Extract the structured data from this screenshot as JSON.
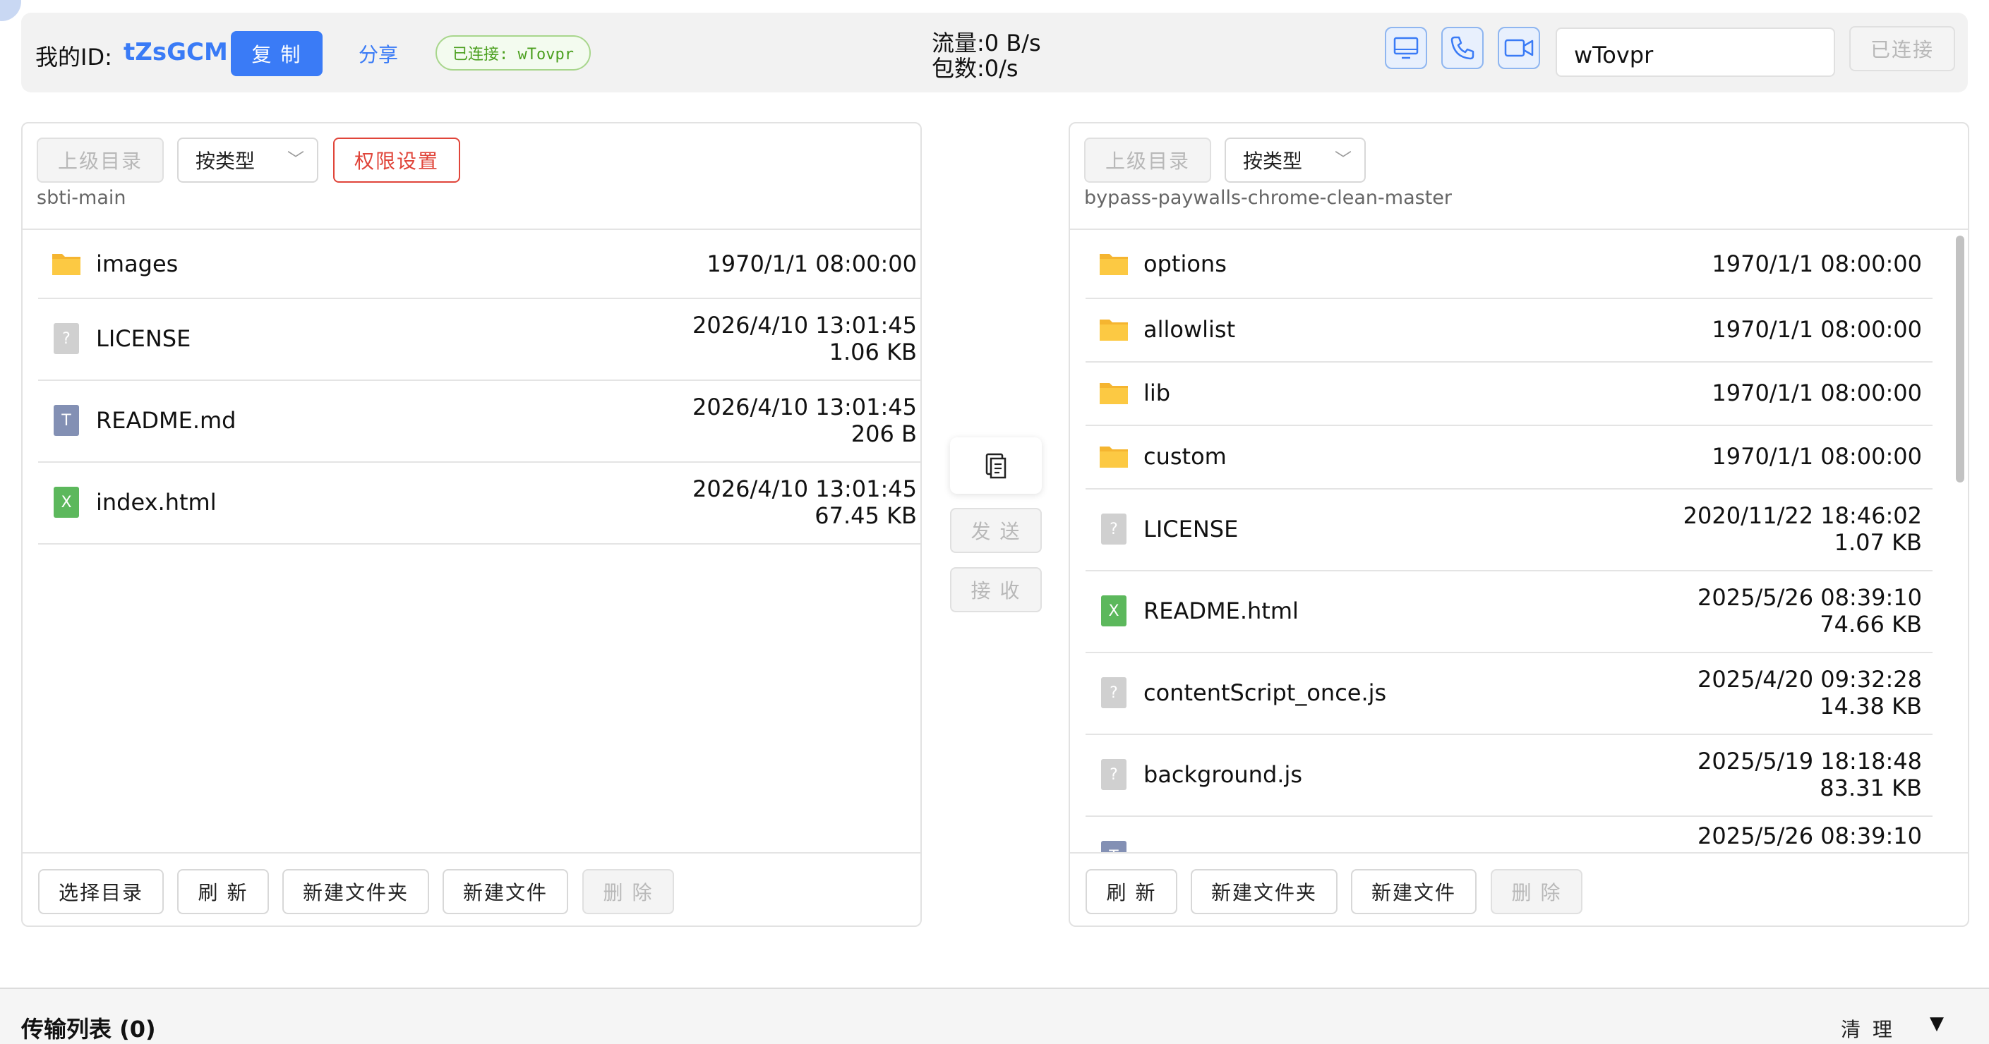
{
  "topbar": {
    "my_id_label": "我的ID:",
    "my_id_value": "tZsGCM",
    "copy_button": "复 制",
    "share_link": "分享",
    "connected_tag": "已连接: wTovpr",
    "traffic": "流量:0 B/s",
    "packets": "包数:0/s",
    "remote_id_input_value": "wTovpr",
    "connect_button": "已连接",
    "icons": [
      "monitor-icon",
      "phone-icon",
      "video-camera-icon"
    ],
    "accent_color": "#3a7bf6"
  },
  "local": {
    "up_button": "上级目录",
    "sort_select": "按类型",
    "permissions_button": "权限设置",
    "path": "sbti-main",
    "files": [
      {
        "name": "images",
        "type": "folder",
        "date": "1970/1/1 08:00:00",
        "size": ""
      },
      {
        "name": "LICENSE",
        "type": "unknown",
        "date": "2026/4/10 13:01:45",
        "size": "1.06 KB"
      },
      {
        "name": "README.md",
        "type": "text",
        "date": "2026/4/10 13:01:45",
        "size": "206 B"
      },
      {
        "name": "index.html",
        "type": "html",
        "date": "2026/4/10 13:01:45",
        "size": "67.45 KB"
      }
    ],
    "footer": {
      "select_dir": "选择目录",
      "refresh": "刷 新",
      "new_folder": "新建文件夹",
      "new_file": "新建文件",
      "delete": "删 除"
    }
  },
  "transfer": {
    "send": "发 送",
    "receive": "接 收"
  },
  "remote": {
    "up_button": "上级目录",
    "sort_select": "按类型",
    "path": "bypass-paywalls-chrome-clean-master",
    "files": [
      {
        "name": "options",
        "type": "folder",
        "date": "1970/1/1 08:00:00",
        "size": ""
      },
      {
        "name": "allowlist",
        "type": "folder",
        "date": "1970/1/1 08:00:00",
        "size": ""
      },
      {
        "name": "lib",
        "type": "folder",
        "date": "1970/1/1 08:00:00",
        "size": ""
      },
      {
        "name": "custom",
        "type": "folder",
        "date": "1970/1/1 08:00:00",
        "size": ""
      },
      {
        "name": "LICENSE",
        "type": "unknown",
        "date": "2020/11/22 18:46:02",
        "size": "1.07 KB"
      },
      {
        "name": "README.html",
        "type": "html",
        "date": "2025/5/26 08:39:10",
        "size": "74.66 KB"
      },
      {
        "name": "contentScript_once.js",
        "type": "unknown",
        "date": "2025/4/20 09:32:28",
        "size": "14.38 KB"
      },
      {
        "name": "background.js",
        "type": "unknown",
        "date": "2025/5/19 18:18:48",
        "size": "83.31 KB"
      },
      {
        "name": "",
        "type": "text",
        "date": "2025/5/26 08:39:10",
        "size": ""
      }
    ],
    "footer": {
      "refresh": "刷 新",
      "new_folder": "新建文件夹",
      "new_file": "新建文件",
      "delete": "删 除"
    }
  },
  "transfer_list": {
    "title": "传输列表 (0)",
    "clear": "清 理",
    "toggle": "▼"
  }
}
